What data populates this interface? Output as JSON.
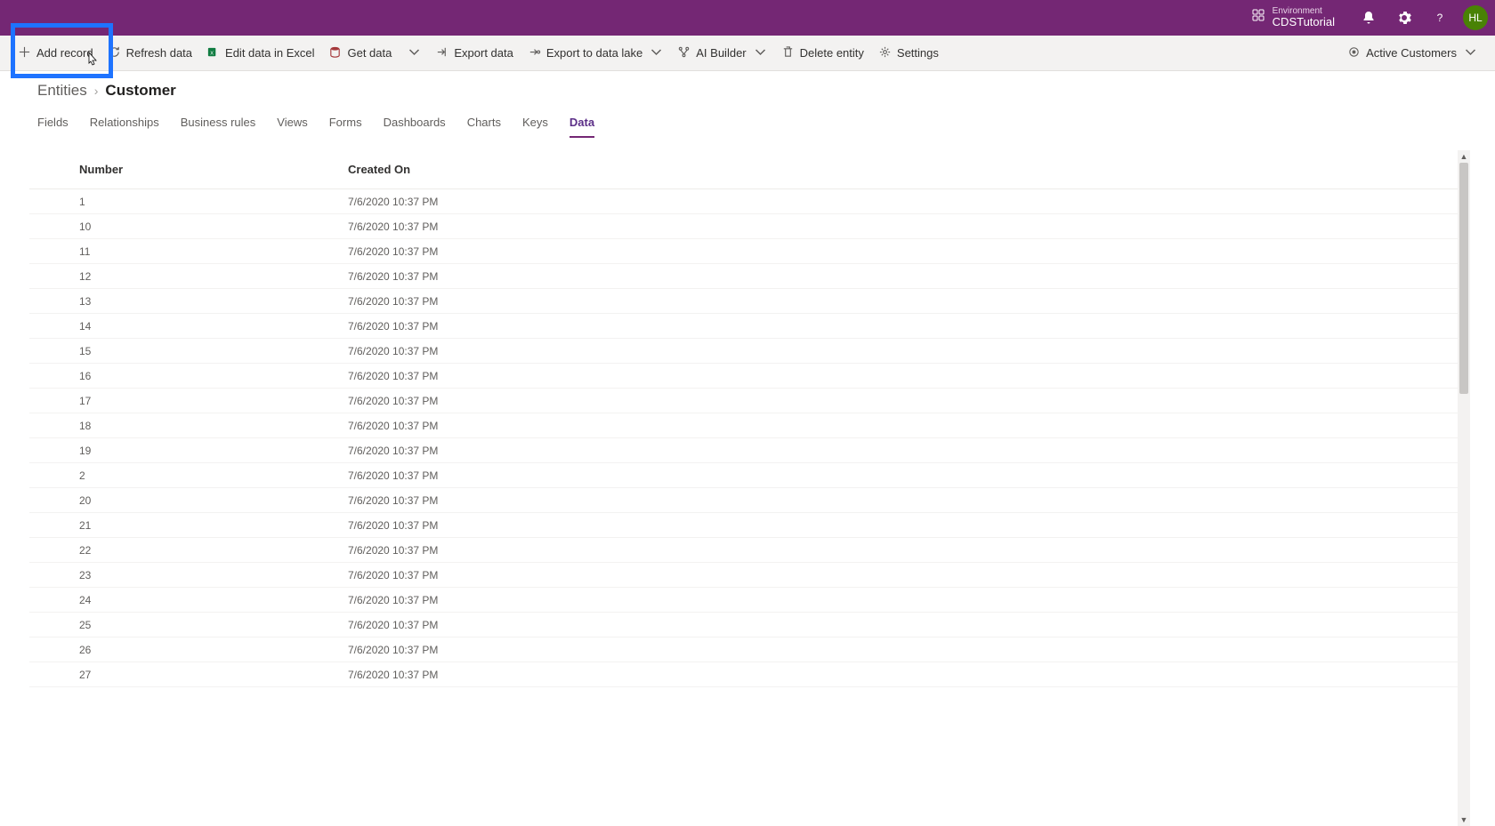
{
  "header": {
    "env_label": "Environment",
    "env_name": "CDSTutorial",
    "avatar_initials": "HL"
  },
  "commandbar": {
    "add_record": "Add record",
    "refresh": "Refresh data",
    "edit_excel": "Edit data in Excel",
    "get_data": "Get data",
    "export_data": "Export data",
    "export_lake": "Export to data lake",
    "ai_builder": "AI Builder",
    "delete_entity": "Delete entity",
    "settings": "Settings",
    "view_selector": "Active Customers"
  },
  "breadcrumb": {
    "parent": "Entities",
    "current": "Customer"
  },
  "tabs": {
    "fields": "Fields",
    "relationships": "Relationships",
    "business_rules": "Business rules",
    "views": "Views",
    "forms": "Forms",
    "dashboards": "Dashboards",
    "charts": "Charts",
    "keys": "Keys",
    "data": "Data"
  },
  "table": {
    "col_number": "Number",
    "col_created": "Created On",
    "rows": [
      {
        "number": "1",
        "created": "7/6/2020 10:37 PM"
      },
      {
        "number": "10",
        "created": "7/6/2020 10:37 PM"
      },
      {
        "number": "11",
        "created": "7/6/2020 10:37 PM"
      },
      {
        "number": "12",
        "created": "7/6/2020 10:37 PM"
      },
      {
        "number": "13",
        "created": "7/6/2020 10:37 PM"
      },
      {
        "number": "14",
        "created": "7/6/2020 10:37 PM"
      },
      {
        "number": "15",
        "created": "7/6/2020 10:37 PM"
      },
      {
        "number": "16",
        "created": "7/6/2020 10:37 PM"
      },
      {
        "number": "17",
        "created": "7/6/2020 10:37 PM"
      },
      {
        "number": "18",
        "created": "7/6/2020 10:37 PM"
      },
      {
        "number": "19",
        "created": "7/6/2020 10:37 PM"
      },
      {
        "number": "2",
        "created": "7/6/2020 10:37 PM"
      },
      {
        "number": "20",
        "created": "7/6/2020 10:37 PM"
      },
      {
        "number": "21",
        "created": "7/6/2020 10:37 PM"
      },
      {
        "number": "22",
        "created": "7/6/2020 10:37 PM"
      },
      {
        "number": "23",
        "created": "7/6/2020 10:37 PM"
      },
      {
        "number": "24",
        "created": "7/6/2020 10:37 PM"
      },
      {
        "number": "25",
        "created": "7/6/2020 10:37 PM"
      },
      {
        "number": "26",
        "created": "7/6/2020 10:37 PM"
      },
      {
        "number": "27",
        "created": "7/6/2020 10:37 PM"
      }
    ]
  }
}
